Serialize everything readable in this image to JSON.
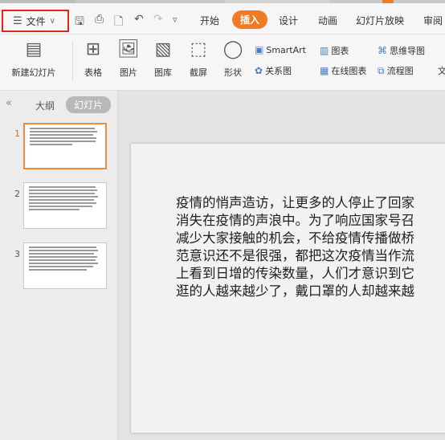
{
  "menubar": {
    "file_label": "文件",
    "tabs": [
      {
        "label": "开始",
        "active": false
      },
      {
        "label": "插入",
        "active": true
      },
      {
        "label": "设计",
        "active": false
      },
      {
        "label": "动画",
        "active": false
      },
      {
        "label": "幻灯片放映",
        "active": false
      },
      {
        "label": "审阅",
        "active": false
      }
    ],
    "accent_color": "#f07b27",
    "highlight_color": "#e8231c"
  },
  "ribbon": {
    "new_slide": "新建幻灯片",
    "table": "表格",
    "picture": "图片",
    "gallery": "图库",
    "screenshot": "截屏",
    "shape": "形状",
    "smartart": "SmartArt",
    "chart": "图表",
    "relation": "关系图",
    "online_chart": "在线图表",
    "mindmap": "思维导图",
    "flowchart": "流程图",
    "text_partial": "文"
  },
  "left_panel": {
    "tab_outline": "大纲",
    "tab_slides": "幻灯片",
    "slides": [
      {
        "number": "1",
        "selected": true
      },
      {
        "number": "2",
        "selected": false
      },
      {
        "number": "3",
        "selected": false
      }
    ]
  },
  "slide": {
    "lines": [
      "疫情的悄声造访，让更多的人停止了回家",
      "消失在疫情的声浪中。为了响应国家号召",
      "减少大家接触的机会，不给疫情传播做桥",
      "范意识还不是很强，都把这次疫情当作流",
      "上看到日增的传染数量，人们才意识到它",
      "逛的人越来越少了，戴口罩的人却越来越"
    ]
  }
}
